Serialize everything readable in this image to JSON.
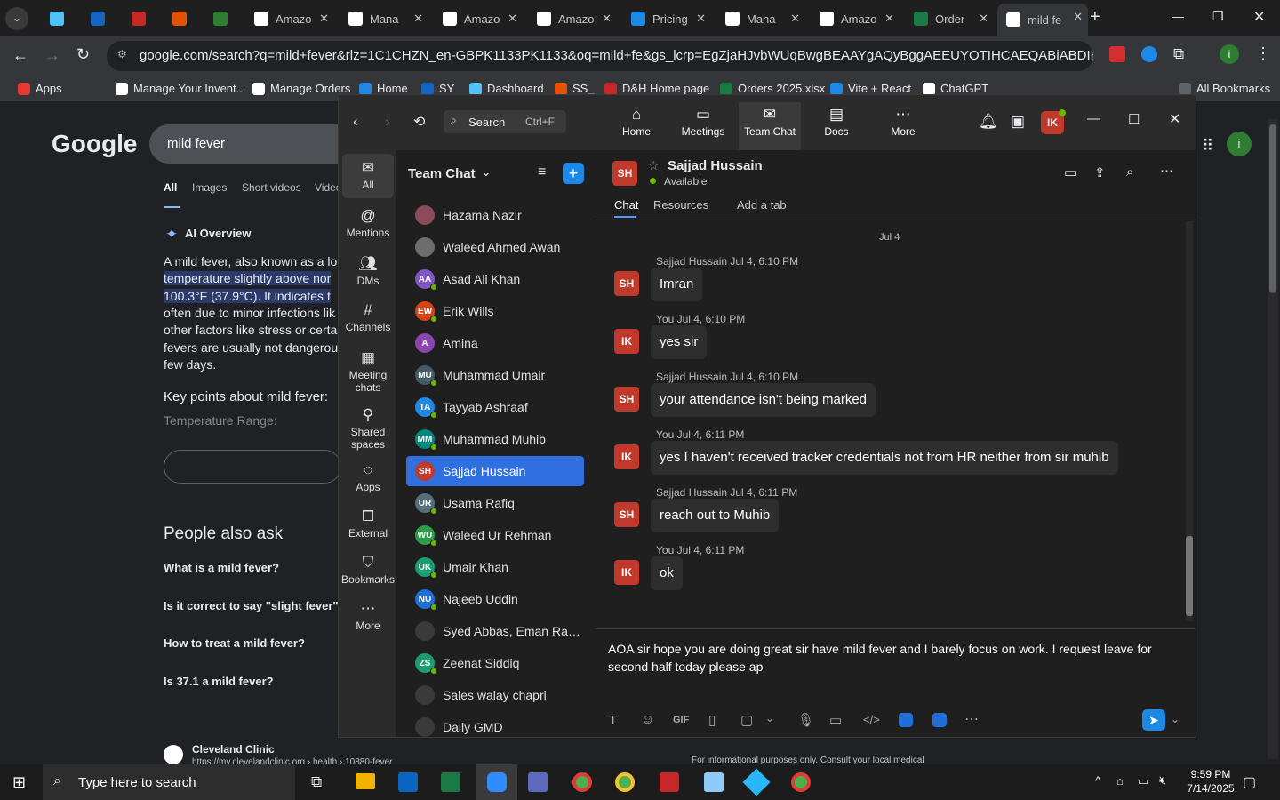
{
  "browser": {
    "tabs": [
      {
        "label": "",
        "icon": "diamond-icon",
        "color": "#4fc3f7"
      },
      {
        "label": "",
        "icon": "ec-icon",
        "color": "#1565c0"
      },
      {
        "label": "",
        "icon": "dh-icon",
        "color": "#c62828"
      },
      {
        "label": "",
        "icon": "box-icon",
        "color": "#e65100"
      },
      {
        "label": "",
        "icon": "g-icon",
        "color": "#2e7d32"
      },
      {
        "label": "Amazo",
        "icon": "amazon-icon",
        "color": "#ffffff"
      },
      {
        "label": "Mana",
        "icon": "amazon-icon",
        "color": "#ffffff"
      },
      {
        "label": "Amazo",
        "icon": "amazon-icon",
        "color": "#ffffff"
      },
      {
        "label": "Amazo",
        "icon": "amazon-icon",
        "color": "#ffffff"
      },
      {
        "label": "Pricing",
        "icon": "dollar-icon",
        "color": "#1e88e5"
      },
      {
        "label": "Mana",
        "icon": "amazon-icon",
        "color": "#ffffff"
      },
      {
        "label": "Amazo",
        "icon": "amazon-icon",
        "color": "#ffffff"
      },
      {
        "label": "Order",
        "icon": "excel-icon",
        "color": "#1b7a43"
      },
      {
        "label": "mild fe",
        "icon": "google-icon",
        "color": "#ffffff"
      }
    ],
    "url": "google.com/search?q=mild+fever&rlz=1C1CHZN_en-GBPK1133PK1133&oq=mild+fe&gs_lcrp=EgZjaHJvbWUqBwgBEAAYgAQyBggAEEUYOTIHCAEQABiABDIH...",
    "bookmarks": [
      "Apps",
      "Manage Your Invent...",
      "Manage Orders",
      "Home",
      "SY",
      "Dashboard",
      "SS_",
      "D&H Home page",
      "Orders 2025.xlsx",
      "Vite + React",
      "ChatGPT"
    ],
    "all_bookmarks": "All Bookmarks"
  },
  "google": {
    "logo": "Google",
    "query": "mild fever",
    "tabs": [
      "All",
      "Images",
      "Short videos",
      "Video"
    ],
    "ai_overview": "AI Overview",
    "overview_lines": [
      "A mild fever, also known as a lo",
      "temperature slightly above nor",
      "100.3°F (37.9°C). It indicates t",
      "often due to minor infections lik",
      "other factors like stress or certa",
      "fevers are usually not dangerou",
      "few days."
    ],
    "key_points": "Key points about mild fever:",
    "temp_range": "Temperature Range:",
    "people_also_ask": "People also ask",
    "questions": [
      "What is a mild fever?",
      "Is it correct to say \"slight fever\"?",
      "How to treat a mild fever?",
      "Is 37.1 a mild fever?"
    ],
    "source": "Cleveland Clinic",
    "source_url": "https://my.clevelandclinic.org › health › 10880-fever",
    "disclaimer": "For informational purposes only. Consult your local medical"
  },
  "teams": {
    "search_label": "Search",
    "search_shortcut": "Ctrl+F",
    "nav": [
      {
        "label": "Home",
        "icon": "home-icon"
      },
      {
        "label": "Meetings",
        "icon": "video-icon"
      },
      {
        "label": "Team Chat",
        "icon": "chat-icon"
      },
      {
        "label": "Docs",
        "icon": "docs-icon"
      },
      {
        "label": "More",
        "icon": "more-icon"
      }
    ],
    "user_initials": "IK",
    "rail": [
      {
        "label": "All",
        "icon": "chat-bubble-icon"
      },
      {
        "label": "Mentions",
        "icon": "at-icon"
      },
      {
        "label": "DMs",
        "icon": "people-icon"
      },
      {
        "label": "Channels",
        "icon": "hash-icon"
      },
      {
        "label": "Meeting chats",
        "icon": "calendar-icon"
      },
      {
        "label": "Shared spaces",
        "icon": "share-icon"
      },
      {
        "label": "Apps",
        "icon": "apps-icon"
      },
      {
        "label": "External",
        "icon": "external-icon"
      },
      {
        "label": "Bookmarks",
        "icon": "bookmark-icon"
      },
      {
        "label": "More",
        "icon": "more-icon"
      }
    ],
    "list_title": "Team Chat",
    "contacts": [
      {
        "name": "Hazama Nazir",
        "initials": "",
        "color": "#8d4a5a"
      },
      {
        "name": "Waleed Ahmed Awan",
        "initials": "",
        "color": "#6d6d6d"
      },
      {
        "name": "Asad Ali Khan",
        "initials": "AA",
        "color": "#7e57c2"
      },
      {
        "name": "Erik Wills",
        "initials": "EW",
        "color": "#d84315"
      },
      {
        "name": "Amina",
        "initials": "A",
        "color": "#8e44ad"
      },
      {
        "name": "Muhammad Umair",
        "initials": "MU",
        "color": "#455a64"
      },
      {
        "name": "Tayyab Ashraaf",
        "initials": "TA",
        "color": "#1e88e5"
      },
      {
        "name": "Muhammad Muhib",
        "initials": "MM",
        "color": "#00897b"
      },
      {
        "name": "Sajjad Hussain",
        "initials": "SH",
        "color": "#c0392b"
      },
      {
        "name": "Usama Rafiq",
        "initials": "UR",
        "color": "#546e7a"
      },
      {
        "name": "Waleed Ur Rehman",
        "initials": "WU",
        "color": "#2e9d49"
      },
      {
        "name": "Umair Khan",
        "initials": "UK",
        "color": "#1b9e6f"
      },
      {
        "name": "Najeeb Uddin",
        "initials": "NU",
        "color": "#1e6fd8"
      },
      {
        "name": "Syed Abbas, Eman Rauf...",
        "initials": "",
        "color": "#3a3a3a"
      },
      {
        "name": "Zeenat Siddiq",
        "initials": "ZS",
        "color": "#1b9e6f"
      },
      {
        "name": "Sales walay chapri",
        "initials": "",
        "color": "#3a3a3a"
      },
      {
        "name": "Daily GMD",
        "initials": "",
        "color": "#3a3a3a"
      }
    ],
    "chat_header": {
      "initials": "SH",
      "name": "Sajjad Hussain",
      "status": "Available"
    },
    "chat_tabs": [
      "Chat",
      "Resources",
      "Add a tab"
    ],
    "date_divider": "Jul 4",
    "messages": [
      {
        "initials": "SH",
        "meta": "Sajjad Hussain Jul 4, 6:10 PM",
        "text": "Imran",
        "color": "#c0392b"
      },
      {
        "initials": "IK",
        "meta": "You Jul 4, 6:10 PM",
        "text": "yes sir",
        "color": "#c0392b"
      },
      {
        "initials": "SH",
        "meta": "Sajjad Hussain Jul 4, 6:10 PM",
        "text": "your attendance isn't being marked",
        "color": "#c0392b"
      },
      {
        "initials": "IK",
        "meta": "You Jul 4, 6:11 PM",
        "text": "yes I haven't received tracker credentials not from HR neither from sir muhib",
        "color": "#c0392b"
      },
      {
        "initials": "SH",
        "meta": "Sajjad Hussain Jul 4, 6:11 PM",
        "text": "reach out to Muhib",
        "color": "#c0392b"
      },
      {
        "initials": "IK",
        "meta": "You Jul 4, 6:11 PM",
        "text": "ok",
        "color": "#c0392b"
      }
    ],
    "composer_text": "AOA sir hope you are doing great  sir have mild fever and I barely focus on work. I request leave for second half today  please ap"
  },
  "taskbar": {
    "search_placeholder": "Type here to search",
    "time": "9:59 PM",
    "date": "7/14/2025"
  }
}
